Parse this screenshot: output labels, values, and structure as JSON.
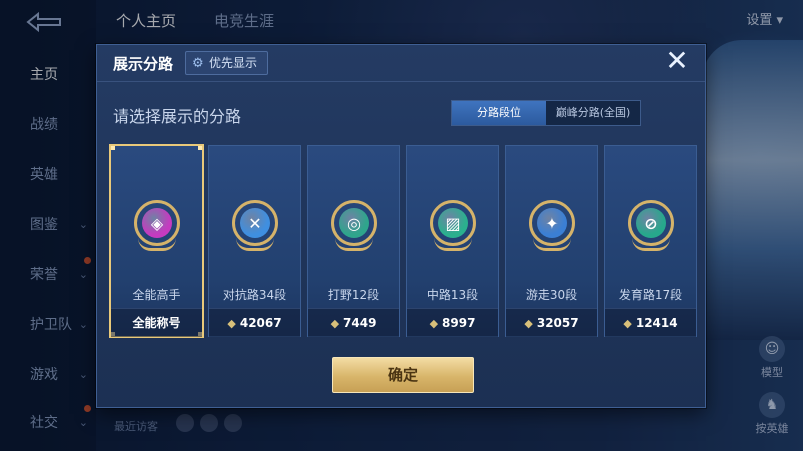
{
  "background": {
    "nav": [
      {
        "label": "主页",
        "active": true
      },
      {
        "label": "战绩"
      },
      {
        "label": "英雄"
      },
      {
        "label": "图鉴"
      },
      {
        "label": "荣誉"
      },
      {
        "label": "护卫队"
      },
      {
        "label": "游戏"
      },
      {
        "label": "社交"
      }
    ],
    "tabs": [
      "个人主页",
      "电竞生涯"
    ],
    "settings_label": "设置",
    "side_buttons": [
      {
        "label": "模型",
        "icon": "person-icon"
      },
      {
        "label": "按英雄",
        "icon": "hero-icon"
      }
    ],
    "recent_label": "最近访客"
  },
  "modal": {
    "title": "展示分路",
    "pref_label": "优先显示",
    "prompt": "请选择展示的分路",
    "segment": [
      "分路段位",
      "巅峰分路(全国)"
    ],
    "confirm": "确定",
    "cards": [
      {
        "name": "全能高手",
        "stat": "全能称号",
        "color": "#c53bc0",
        "icon": "all-round-emblem-icon",
        "glyph": "◈",
        "selected": true
      },
      {
        "name": "对抗路34段",
        "stat": "42067",
        "color": "#3f8fe0",
        "icon": "clash-lane-emblem-icon",
        "glyph": "✕"
      },
      {
        "name": "打野12段",
        "stat": "7449",
        "color": "#2fa58c",
        "icon": "jungle-emblem-icon",
        "glyph": "◎"
      },
      {
        "name": "中路13段",
        "stat": "8997",
        "color": "#2bb08e",
        "icon": "mid-lane-emblem-icon",
        "glyph": "▨"
      },
      {
        "name": "游走30段",
        "stat": "32057",
        "color": "#3b7fd4",
        "icon": "roam-emblem-icon",
        "glyph": "✦"
      },
      {
        "name": "发育路17段",
        "stat": "12414",
        "color": "#27a88c",
        "icon": "farm-lane-emblem-icon",
        "glyph": "⊘"
      }
    ]
  }
}
